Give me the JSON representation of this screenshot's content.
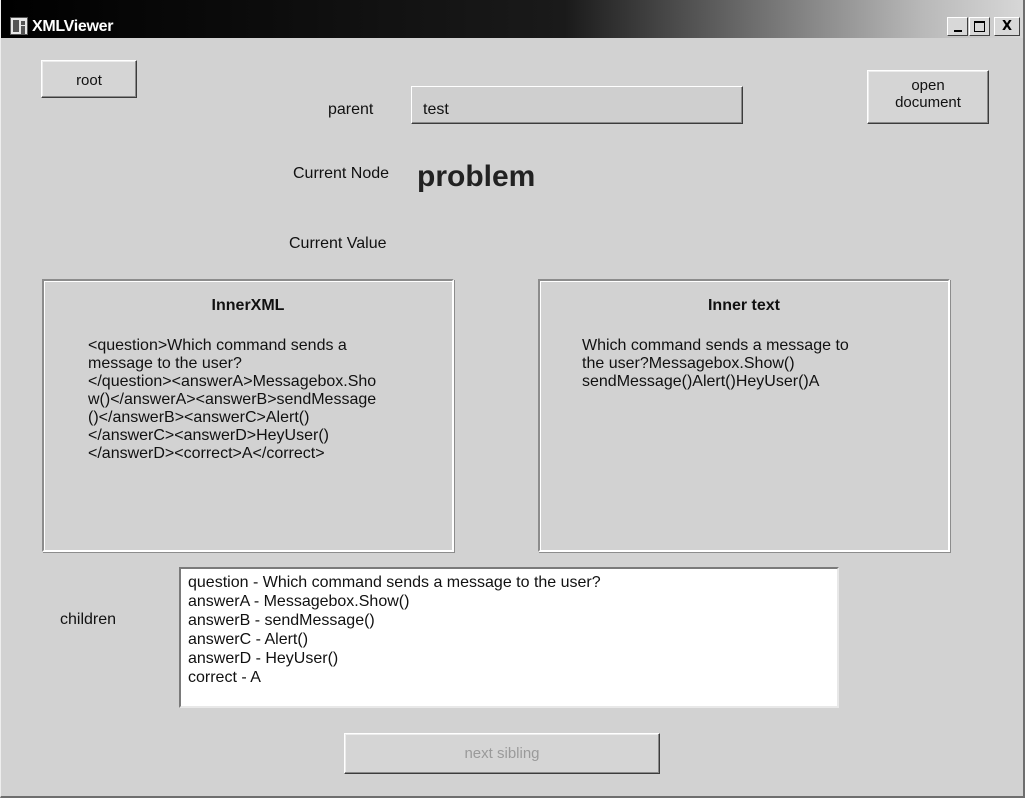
{
  "window": {
    "title": "XMLViewer",
    "controls": {
      "minimize": "_",
      "maximize": "□",
      "close": "X"
    }
  },
  "buttons": {
    "root": "root",
    "open_line1": "open",
    "open_line2": "document",
    "next_sibling": "next sibling"
  },
  "parent": {
    "label": "parent",
    "value": "test"
  },
  "current_node": {
    "label": "Current Node",
    "value": "problem"
  },
  "current_value": {
    "label": "Current Value",
    "value": ""
  },
  "inner_xml": {
    "title": "InnerXML",
    "lines": [
      "<question>Which command sends a",
      "message to the user?",
      "</question><answerA>Messagebox.Sho",
      "w()</answerA><answerB>sendMessage",
      "()</answerB><answerC>Alert()",
      "</answerC><answerD>HeyUser()",
      "</answerD><correct>A</correct>"
    ]
  },
  "inner_text": {
    "title": "Inner text",
    "lines": [
      "Which command sends a message to",
      "the user?Messagebox.Show()",
      "sendMessage()Alert()HeyUser()A"
    ]
  },
  "children": {
    "label": "children",
    "items": [
      "question - Which command sends a message to the user?",
      "answerA - Messagebox.Show()",
      "answerB - sendMessage()",
      "answerC - Alert()",
      "answerD - HeyUser()",
      "correct - A"
    ]
  }
}
